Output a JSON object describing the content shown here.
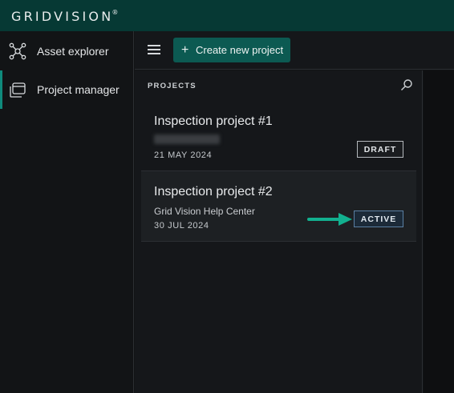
{
  "app": {
    "logo_text": "GRIDVISION",
    "logo_mark": "®"
  },
  "sidebar": {
    "items": [
      {
        "label": "Asset explorer",
        "icon": "network-nodes-icon",
        "active": false
      },
      {
        "label": "Project manager",
        "icon": "calendar-folder-icon",
        "active": true
      }
    ]
  },
  "toolbar": {
    "create_label": "Create new project",
    "create_icon": "plus-icon"
  },
  "projects": {
    "heading": "PROJECTS",
    "items": [
      {
        "title": "Inspection project  #1",
        "subtitle_blurred": true,
        "date": "21 MAY 2024",
        "status": "DRAFT"
      },
      {
        "title": "Inspection project  #2",
        "subtitle": "Grid Vision Help Center",
        "date": "30 JUL 2024",
        "status": "ACTIVE"
      }
    ]
  },
  "colors": {
    "topbar": "#063934",
    "accent": "#0c5a52",
    "arrow": "#12b08f",
    "active_badge_border": "#5a7fa3"
  }
}
